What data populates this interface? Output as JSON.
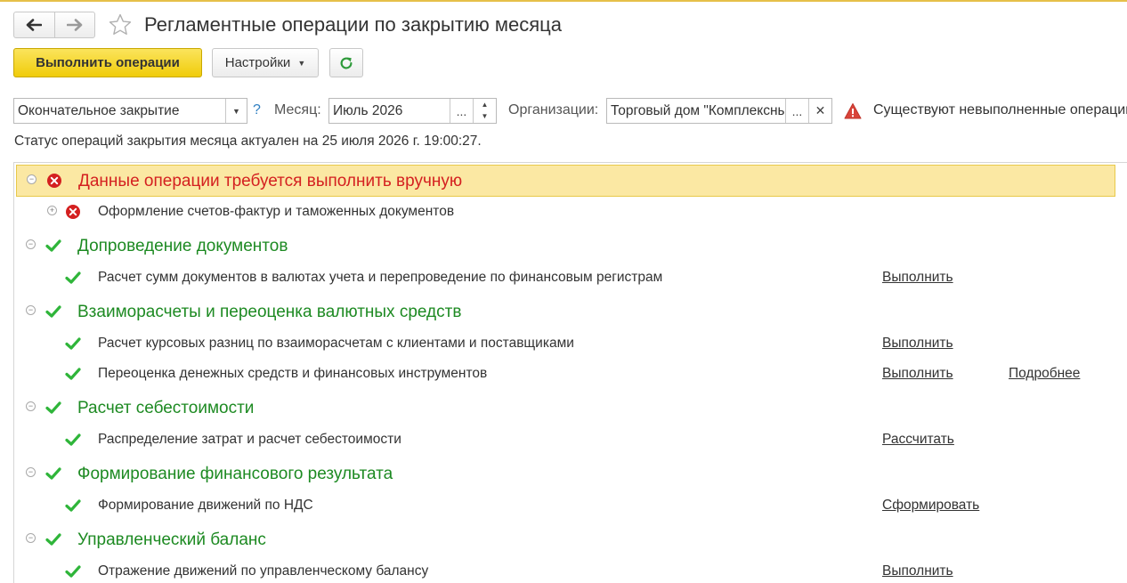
{
  "window": {
    "title": "Регламентные операции по закрытию месяца"
  },
  "toolbar": {
    "execute_label": "Выполнить операции",
    "settings_label": "Настройки"
  },
  "filters": {
    "closing_type": "Окончательное закрытие",
    "help": "?",
    "month_label": "Месяц:",
    "month_value": "Июль 2026",
    "org_label": "Организации:",
    "org_value": "Торговый дом \"Комплексный\"",
    "dots": "...",
    "warning_text": "Существуют невыполненные операции"
  },
  "status_text": "Статус операций закрытия месяца актуален на 25 июля 2026 г. 19:00:27.",
  "groups": [
    {
      "title": "Данные операции требуется выполнить вручную",
      "status": "error",
      "items": [
        {
          "text": "Оформление счетов-фактур и таможенных документов",
          "status": "error",
          "actions": []
        }
      ]
    },
    {
      "title": "Допроведение документов",
      "status": "ok",
      "items": [
        {
          "text": "Расчет сумм документов в валютах учета и перепроведение по финансовым регистрам",
          "status": "ok",
          "actions": [
            "Выполнить"
          ]
        }
      ]
    },
    {
      "title": "Взаиморасчеты и переоценка валютных средств",
      "status": "ok",
      "items": [
        {
          "text": "Расчет курсовых разниц по взаиморасчетам с клиентами и поставщиками",
          "status": "ok",
          "actions": [
            "Выполнить"
          ]
        },
        {
          "text": "Переоценка денежных средств и финансовых инструментов",
          "status": "ok",
          "actions": [
            "Выполнить",
            "Подробнее"
          ]
        }
      ]
    },
    {
      "title": "Расчет себестоимости",
      "status": "ok",
      "items": [
        {
          "text": "Распределение затрат и расчет себестоимости",
          "status": "ok",
          "actions": [
            "Рассчитать"
          ]
        }
      ]
    },
    {
      "title": "Формирование финансового результата",
      "status": "ok",
      "items": [
        {
          "text": "Формирование движений по НДС",
          "status": "ok",
          "actions": [
            "Сформировать"
          ]
        }
      ]
    },
    {
      "title": "Управленческий баланс",
      "status": "ok",
      "items": [
        {
          "text": "Отражение движений по управленческому балансу",
          "status": "ok",
          "actions": [
            "Выполнить"
          ]
        }
      ]
    }
  ],
  "colors": {
    "error": "#d42020",
    "ok_green": "#1d8a22",
    "primary_button": "#f4d422",
    "highlight_row": "#fbe8a3"
  },
  "icons": {
    "back": "arrow-left-icon",
    "forward": "arrow-right-icon",
    "favorite": "star-icon",
    "refresh": "refresh-icon",
    "warning": "warning-triangle-icon",
    "error": "error-circle-icon",
    "ok": "check-icon"
  }
}
